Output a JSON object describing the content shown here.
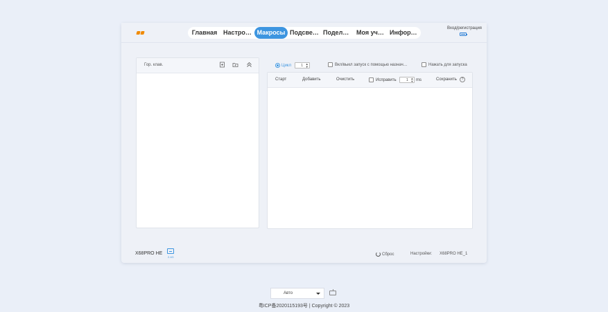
{
  "header": {
    "nav": [
      {
        "label": "Главная",
        "active": false
      },
      {
        "label": "Настрой…",
        "active": false
      },
      {
        "label": "Макросы",
        "active": true
      },
      {
        "label": "Подсветка",
        "active": false
      },
      {
        "label": "Поделит…",
        "active": false
      },
      {
        "label": "Моя учет…",
        "active": false
      },
      {
        "label": "Информ…",
        "active": false
      }
    ],
    "login_label": "Вход/регистрация",
    "accent_color": "#3d95e0",
    "battery_icon": "battery-icon"
  },
  "macro_list": {
    "title": "Гор. клав.",
    "icons": [
      "new-file-icon",
      "import-folder-icon",
      "collapse-icon"
    ]
  },
  "options": {
    "cycle_label": "Цикл",
    "cycle_value": "1",
    "toggle_trigger_label": "Вкл/выкл запуск с помощью назнач…",
    "press_to_run_label": "Нажать для запуска"
  },
  "editor": {
    "start_label": "Старт",
    "add_label": "Добавить",
    "clear_label": "Очистить",
    "fix_label": "Исправить",
    "fix_value": "1",
    "fix_unit": "ms",
    "save_label": "Сохранить"
  },
  "footer": {
    "model": "X68PRO HE",
    "wireless_label": "2.4G",
    "reset_label": "Сброс",
    "settings_label": "Настройки:",
    "profile": "X68PRO HE_1"
  },
  "bottom": {
    "mode": "Авто",
    "copyright": "粤ICP备2020115193号 | Copyright © 2023"
  }
}
